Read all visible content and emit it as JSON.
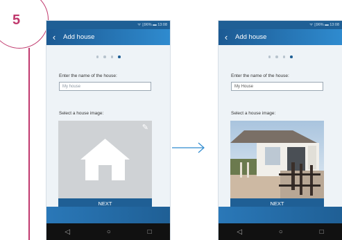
{
  "step": {
    "number": "5"
  },
  "screens": [
    {
      "status_text": "ᯤ ▯96% ▬ 13:08",
      "title": "Add house",
      "name_label": "Enter the name of the house:",
      "name_placeholder": "My house",
      "name_value": "",
      "image_label": "Select a house image:",
      "next_label": "NEXT",
      "image_state": "empty"
    },
    {
      "status_text": "ᯤ ▯96% ▬ 13:08",
      "title": "Add house",
      "name_label": "Enter the name of the house:",
      "name_placeholder": "My House",
      "name_value": "My House",
      "image_label": "Select a house image:",
      "next_label": "NEXT",
      "image_state": "photo"
    }
  ],
  "nav": {
    "back": "◁",
    "home": "○",
    "recent": "□"
  },
  "colors": {
    "accent": "#c0396d",
    "primary": "#1f5f95",
    "appbar_light": "#2f8bcf"
  },
  "icons": {
    "back": "chevron-left-icon",
    "edit": "pencil-icon",
    "house": "house-icon",
    "arrow": "arrow-right-icon"
  }
}
